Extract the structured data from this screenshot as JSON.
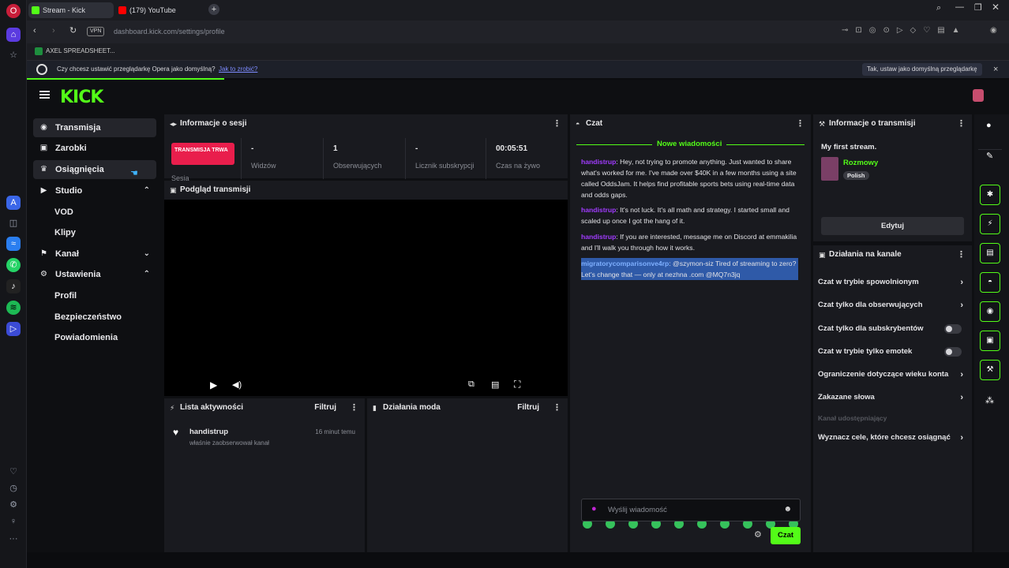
{
  "browser": {
    "tabs": [
      {
        "label": "Stream - Kick Dashboard"
      },
      {
        "label": "(179) YouTube"
      }
    ],
    "new_tab": "+",
    "url": "dashboard.kick.com/settings/profile",
    "vpn": "VPN",
    "bookmark": "AXEL SPREADSHEET...",
    "notify_text": "Czy chcesz ustawić przeglądarkę Opera jako domyślną?",
    "notify_link": "Jak to zrobić?",
    "notify_button": "Tak, ustaw jako domyślną przeglądarkę",
    "notify_close": "×"
  },
  "sidebar": {
    "items": [
      {
        "label": "Transmisja",
        "icon": "(•)"
      },
      {
        "label": "Zarobki",
        "icon": "▣"
      },
      {
        "label": "Osiągnięcia",
        "icon": "♛"
      },
      {
        "label": "Studio",
        "icon": "▶",
        "chev": "⌃"
      },
      {
        "label": "Kanał",
        "icon": "⚑",
        "chev": "⌄"
      },
      {
        "label": "Ustawienia",
        "icon": "⚙",
        "chev": "⌃"
      }
    ],
    "studio_sub": [
      "VOD",
      "Klipy"
    ],
    "settings_sub": [
      "Profil",
      "Bezpieczeństwo",
      "Powiadomienia"
    ]
  },
  "session": {
    "title": "Informacje o sesji",
    "badge": "TRANSMISJA TRWA",
    "badge_sub": "Sesja",
    "stats": [
      {
        "value": "-",
        "label": "Widzów"
      },
      {
        "value": "1",
        "label": "Obserwujących"
      },
      {
        "value": "-",
        "label": "Licznik subskrypcji"
      },
      {
        "value": "00:05:51",
        "label": "Czas na żywo"
      }
    ]
  },
  "preview": {
    "title": "Podgląd transmisji"
  },
  "activity": {
    "title": "Lista aktywności",
    "filter": "Filtruj",
    "user": "handistrup",
    "time": "16 minut temu",
    "desc": "właśnie zaobserwował kanał"
  },
  "mod": {
    "title": "Działania moda",
    "filter": "Filtruj"
  },
  "chat": {
    "title": "Czat",
    "new_messages": "Nowe wiadomości",
    "messages": [
      {
        "user": "handistrup",
        "text": ": Hey, not trying to promote anything. Just wanted to share what's worked for me. I've made over $40K in a few months using a site called OddsJam. It helps find profitable sports bets using real-time data and odds gaps."
      },
      {
        "user": "handistrup",
        "text": ": It's not luck. It's all math and strategy. I started small and scaled up once I got the hang of it."
      },
      {
        "user": "handistrup",
        "text": ": If you are interested, message me on Discord at emmakilia and I'll walk you through how it works."
      },
      {
        "user": "migratorycomparisonve4rp",
        "text": ": @szymon-siz Tired of streaming to zero? Let's change that — only at nezhna .com @MQ7n3jq"
      }
    ],
    "placeholder": "Wyślij wiadomość",
    "send": "Czat"
  },
  "stream_info": {
    "title": "Informacje o transmisji",
    "stream_title": "My first stream.",
    "category": "Rozmowy",
    "language": "Polish",
    "edit": "Edytuj"
  },
  "channel_actions": {
    "title": "Działania na kanale",
    "items": [
      {
        "label": "Czat w trybie spowolnionym",
        "type": "arrow"
      },
      {
        "label": "Czat tylko dla obserwujących",
        "type": "arrow"
      },
      {
        "label": "Czat tylko dla subskrybentów",
        "type": "toggle"
      },
      {
        "label": "Czat w trybie tylko emotek",
        "type": "toggle"
      },
      {
        "label": "Ograniczenie dotyczące wieku konta",
        "type": "arrow"
      },
      {
        "label": "Zakazane słowa",
        "type": "arrow"
      }
    ],
    "disabled": "Kanał udostępniający",
    "goal": "Wyznacz cele, które chcesz osiągnąć"
  }
}
